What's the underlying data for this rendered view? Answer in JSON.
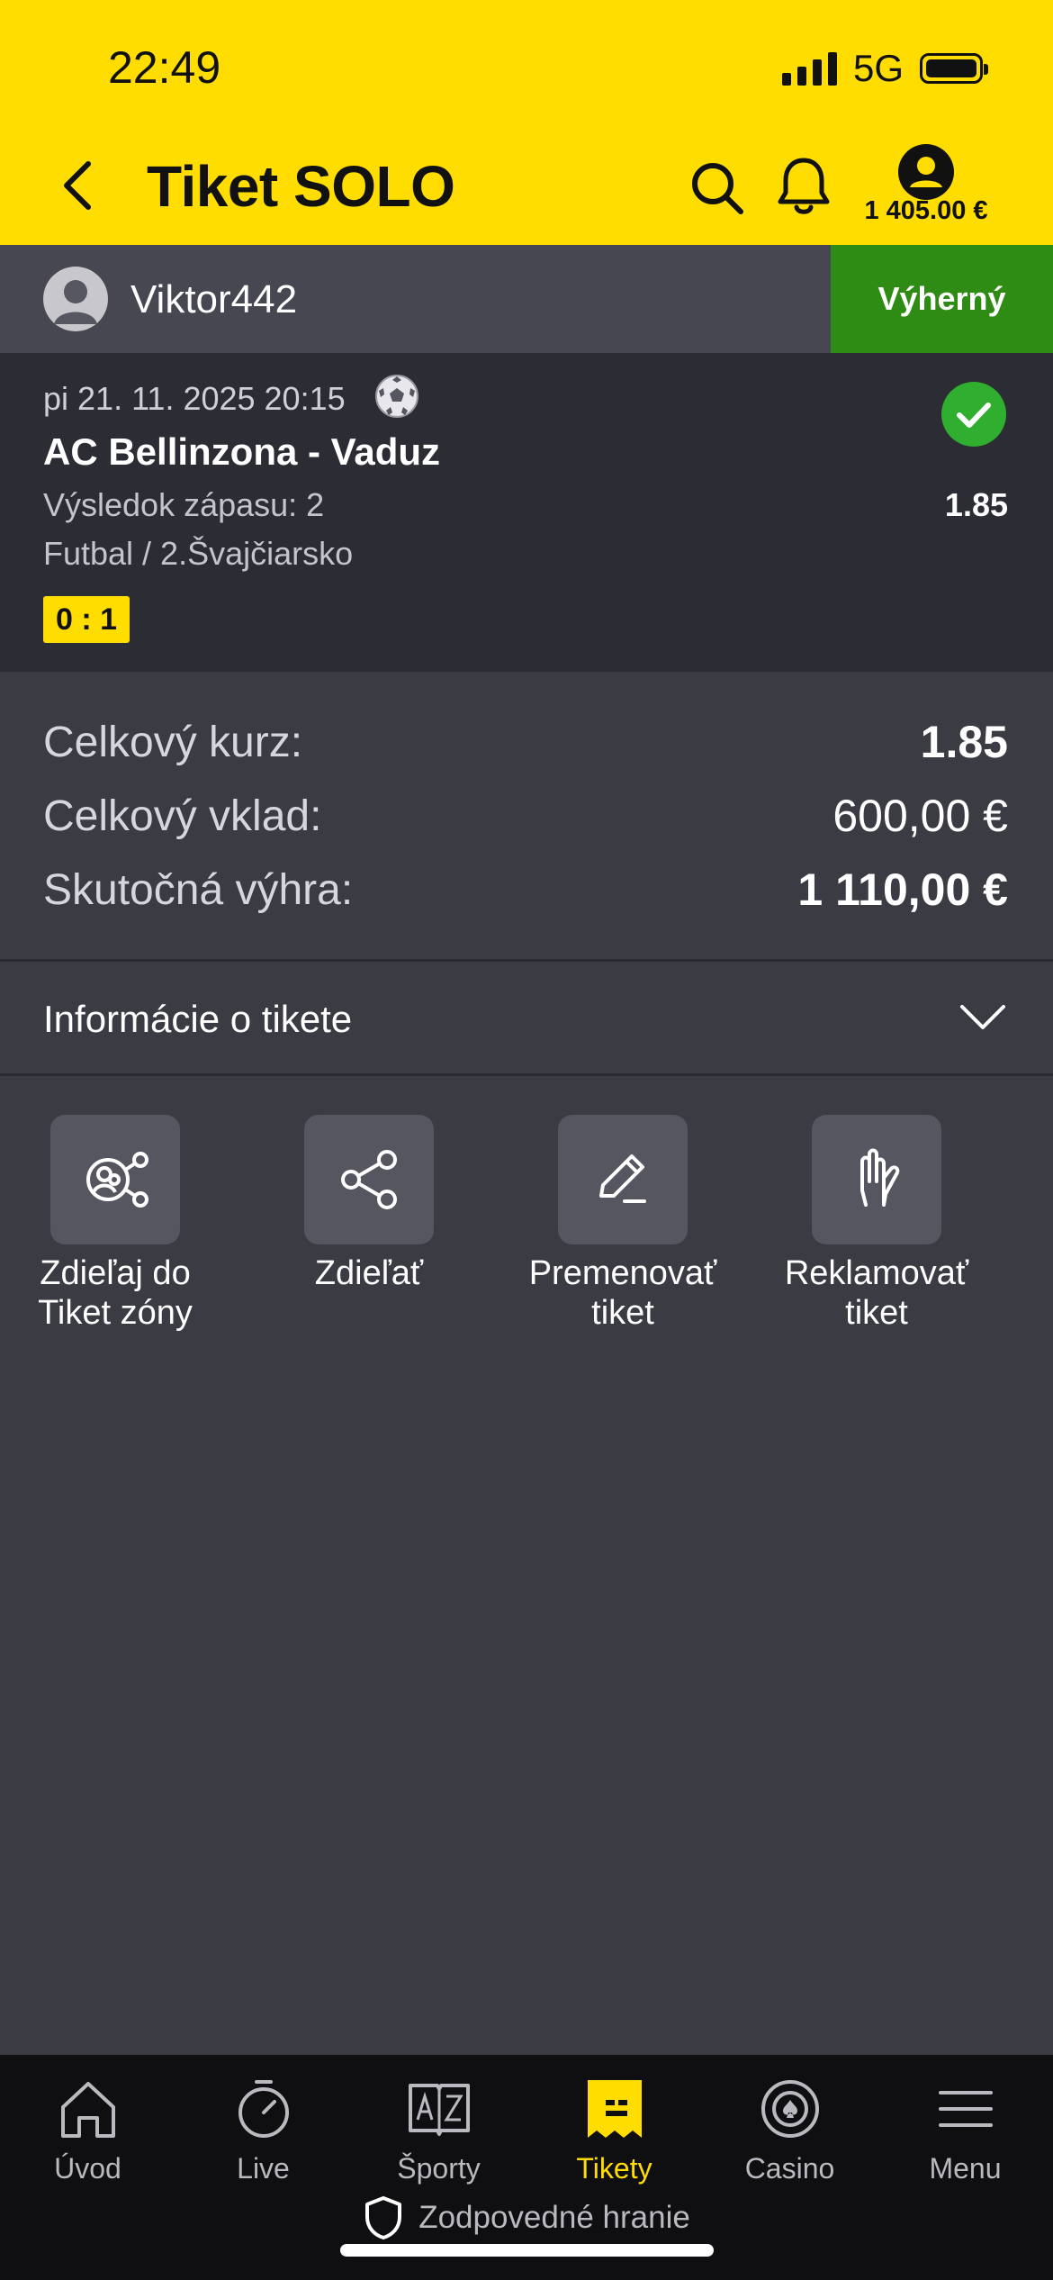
{
  "status_bar": {
    "time": "22:49",
    "network": "5G"
  },
  "header": {
    "title": "Tiket SOLO",
    "balance": "1 405.00 €"
  },
  "user": {
    "name": "Viktor442",
    "status": "Výherný"
  },
  "match": {
    "datetime": "pi 21. 11. 2025 20:15",
    "teams": "AC Bellinzona - Vaduz",
    "market": "Výsledok zápasu: 2",
    "odd": "1.85",
    "league": "Futbal / 2.Švajčiarsko",
    "score": "0 : 1"
  },
  "summary": {
    "total_odds_label": "Celkový kurz:",
    "total_odds": "1.85",
    "total_stake_label": "Celkový vklad:",
    "total_stake": "600,00 €",
    "actual_win_label": "Skutočná výhra:",
    "actual_win": "1 110,00 €"
  },
  "info": {
    "label": "Informácie o tikete"
  },
  "actions": [
    {
      "label": "Zdieľaj do\nTiket zóny"
    },
    {
      "label": "Zdieľať"
    },
    {
      "label": "Premenovať\ntiket"
    },
    {
      "label": "Reklamovať\ntiket"
    }
  ],
  "tabs": [
    {
      "label": "Úvod"
    },
    {
      "label": "Live"
    },
    {
      "label": "Športy"
    },
    {
      "label": "Tikety"
    },
    {
      "label": "Casino"
    },
    {
      "label": "Menu"
    }
  ],
  "responsible": "Zodpovedné hranie",
  "colors": {
    "brand_yellow": "#ffdd00",
    "win_green": "#2e8b14",
    "background": "#3a3b43"
  }
}
